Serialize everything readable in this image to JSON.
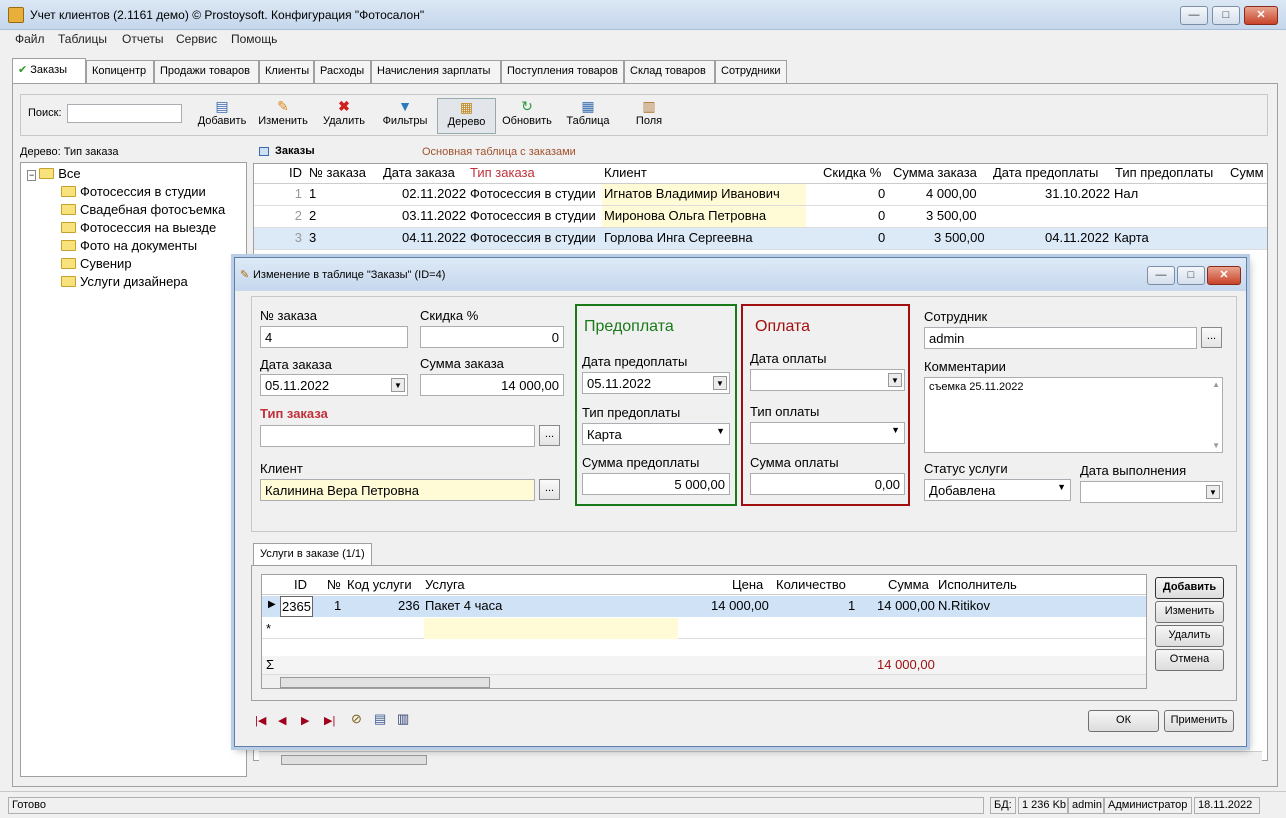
{
  "window": {
    "title": "Учет клиентов (2.1161 демо) © Prostoysoft. Конфигурация \"Фотосалон\"",
    "controls": [
      "—",
      "□",
      "✕"
    ]
  },
  "menu": [
    "Файл",
    "Таблицы",
    "Отчеты",
    "Сервис",
    "Помощь"
  ],
  "tabs": [
    "Заказы",
    "Копицентр",
    "Продажи товаров",
    "Клиенты",
    "Расходы",
    "Начисления зарплаты",
    "Поступления товаров",
    "Склад товаров",
    "Сотрудники"
  ],
  "active_tab_check": "✔",
  "toolbar": {
    "search_label": "Поиск:",
    "search_value": "",
    "buttons": [
      "Добавить",
      "Изменить",
      "Удалить",
      "Фильтры",
      "Дерево",
      "Обновить",
      "Таблица",
      "Поля"
    ]
  },
  "tree": {
    "title": "Дерево: Тип заказа",
    "root": "Все",
    "items": [
      "Фотосессия в студии",
      "Свадебная фотосъемка",
      "Фотосессия на выезде",
      "Фото на документы",
      "Сувенир",
      "Услуги дизайнера"
    ]
  },
  "grid": {
    "title": "Заказы",
    "subtitle": "Основная таблица с заказами",
    "columns": [
      "ID",
      "№ заказа",
      "Дата заказа",
      "Тип заказа",
      "Клиент",
      "Скидка %",
      "Сумма заказа",
      "Дата предоплаты",
      "Тип предоплаты",
      "Сумм"
    ],
    "rows": [
      {
        "rn": "1",
        "id": "1",
        "date": "02.11.2022",
        "type": "Фотосессия в студии",
        "client": "Игнатов Владимир Иванович",
        "disc": "0",
        "sum": "4 000,00",
        "pdate": "31.10.2022",
        "ptype": "Нал"
      },
      {
        "rn": "2",
        "id": "2",
        "date": "03.11.2022",
        "type": "Фотосессия в студии",
        "client": "Миронова Ольга Петровна",
        "disc": "0",
        "sum": "3 500,00",
        "pdate": "",
        "ptype": ""
      },
      {
        "rn": "3",
        "id": "3",
        "date": "04.11.2022",
        "type": "Фотосессия в студии",
        "client": "Горлова Инга Сергеевна",
        "disc": "0",
        "sum": "3 500,00",
        "pdate": "04.11.2022",
        "ptype": "Карта"
      }
    ]
  },
  "dialog": {
    "title": "Изменение в таблице \"Заказы\" (ID=4)",
    "order_no_label": "№ заказа",
    "order_no": "4",
    "discount_label": "Скидка %",
    "discount": "0",
    "date_label": "Дата заказа",
    "date": "05.11.2022",
    "sum_label": "Сумма заказа",
    "sum": "14 000,00",
    "type_label": "Тип заказа",
    "type_value": "",
    "client_label": "Клиент",
    "client": "Калинина Вера Петровна",
    "prepay": {
      "title": "Предоплата",
      "date_label": "Дата предоплаты",
      "date": "05.11.2022",
      "type_label": "Тип предоплаты",
      "type": "Карта",
      "sum_label": "Сумма предоплаты",
      "sum": "5 000,00"
    },
    "pay": {
      "title": "Оплата",
      "date_label": "Дата оплаты",
      "date": "",
      "type_label": "Тип оплаты",
      "type": "",
      "sum_label": "Сумма оплаты",
      "sum": "0,00"
    },
    "employee_label": "Сотрудник",
    "employee": "admin",
    "comments_label": "Комментарии",
    "comments": "съемка 25.11.2022",
    "status_label": "Статус услуги",
    "status": "Добавлена",
    "done_label": "Дата выполнения",
    "done": "",
    "services_tab": "Услуги в заказе (1/1)",
    "services": {
      "columns": [
        "ID",
        "№",
        "Код услуги",
        "Услуга",
        "Цена",
        "Количество",
        "Сумма",
        "Исполнитель"
      ],
      "row": {
        "id": "2365",
        "no": "1",
        "code": "236",
        "name": "Пакет 4 часа",
        "price": "14 000,00",
        "qty": "1",
        "sum": "14 000,00",
        "who": "N.Ritikov"
      },
      "total": "14 000,00",
      "sigma": "Σ",
      "new_row": "*"
    },
    "side_buttons": [
      "Добавить",
      "Изменить",
      "Удалить",
      "Отмена"
    ],
    "ok": "ОК",
    "apply": "Применить",
    "ellipsis": "..."
  },
  "status": {
    "ready": "Готово",
    "db_label": "БД:",
    "db_size": "1 236 Kb",
    "user": "admin",
    "role": "Администратор",
    "date": "18.11.2022"
  },
  "colors": {
    "prepay": "#1a7a1a",
    "pay": "#a01010",
    "accent_red": "#c0303a"
  }
}
